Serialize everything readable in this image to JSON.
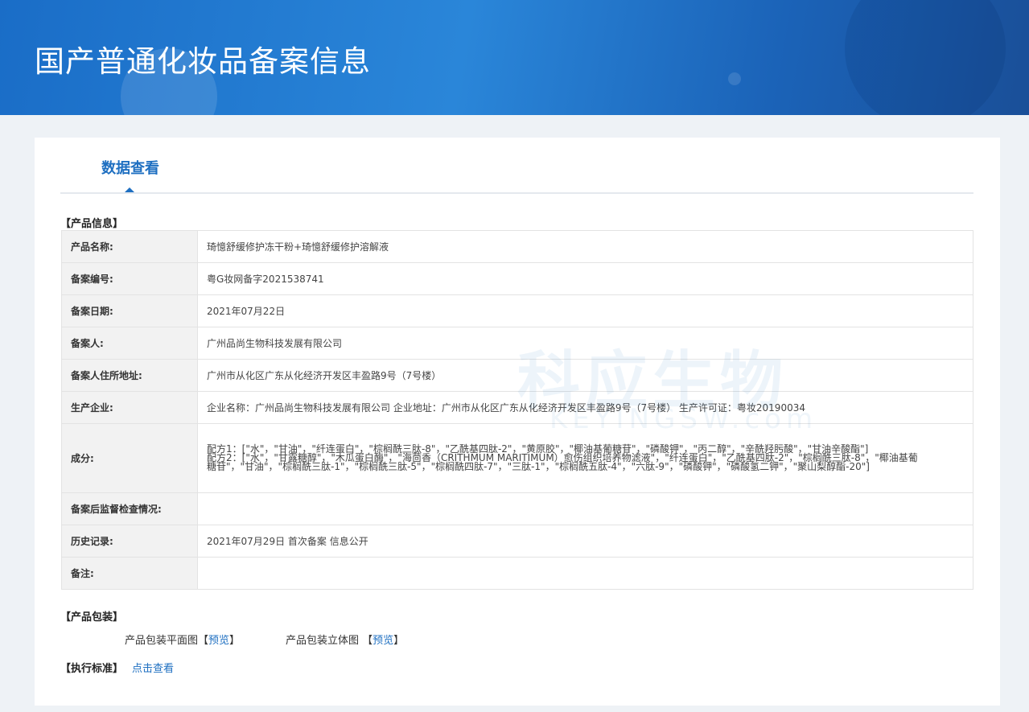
{
  "header": {
    "title": "国产普通化妆品备案信息"
  },
  "tab": {
    "label": "数据查看"
  },
  "product_section": "【产品信息】",
  "watermark": {
    "cn": "科应生物",
    "en": "KEYINGSW.com"
  },
  "rows": [
    {
      "label": "产品名称:",
      "value": "琦憶舒缓修护冻干粉+琦憶舒缓修护溶解液"
    },
    {
      "label": "备案编号:",
      "value": "粤G妆网备字2021538741"
    },
    {
      "label": "备案日期:",
      "value": "2021年07月22日"
    },
    {
      "label": "备案人:",
      "value": "广州品尚生物科技发展有限公司"
    },
    {
      "label": "备案人住所地址:",
      "value": "广州市从化区广东从化经济开发区丰盈路9号（7号楼）"
    },
    {
      "label": "生产企业:",
      "value": "企业名称：广州品尚生物科技发展有限公司 企业地址：广州市从化区广东从化经济开发区丰盈路9号（7号楼） 生产许可证：粤妆20190034"
    },
    {
      "label": "成分:",
      "value": "配方1：[\"水\"，\"甘油\"，\"纤连蛋白\"，\"棕榈酰三肽-8\"，\"乙酰基四肽-2\"，\"黄原胶\"，\"椰油基葡糖苷\"，\"磷酸钾\"，\"丙二醇\"，\"辛酰羟肟酸\"，\"甘油辛酸酯\"]",
      "value2": "配方2：[\"水\"，\"甘露糖醇\"，\"木瓜蛋白酶\"，\"海茴香（CRITHMUM MARITIMUM）愈伤组织培养物滤液\"，\"纤连蛋白\"，\"乙酰基四肽-2\"，\"棕榈酰三肽-8\"，\"椰油基葡糖苷\"，\"甘油\"，\"棕榈酰三肽-1\"，\"棕榈酰三肽-5\"，\"棕榈酰四肽-7\"，\"三肽-1\"，\"棕榈酰五肽-4\"，\"六肽-9\"，\"磷酸钾\"，\"磷酸氢二钾\"，\"聚山梨醇酯-20\"]"
    },
    {
      "label": "备案后监督检查情况:",
      "value": ""
    },
    {
      "label": "历史记录:",
      "value": "2021年07月29日 首次备案 信息公开"
    },
    {
      "label": "备注:",
      "value": ""
    }
  ],
  "packaging": {
    "title": "【产品包装】",
    "flat_label": "产品包装平面图【",
    "flat_link": "预览",
    "flat_close": "】",
    "3d_label": "产品包装立体图 【",
    "3d_link": "预览",
    "3d_close": "】"
  },
  "standard": {
    "title": "【执行标准】",
    "link": "点击查看"
  }
}
